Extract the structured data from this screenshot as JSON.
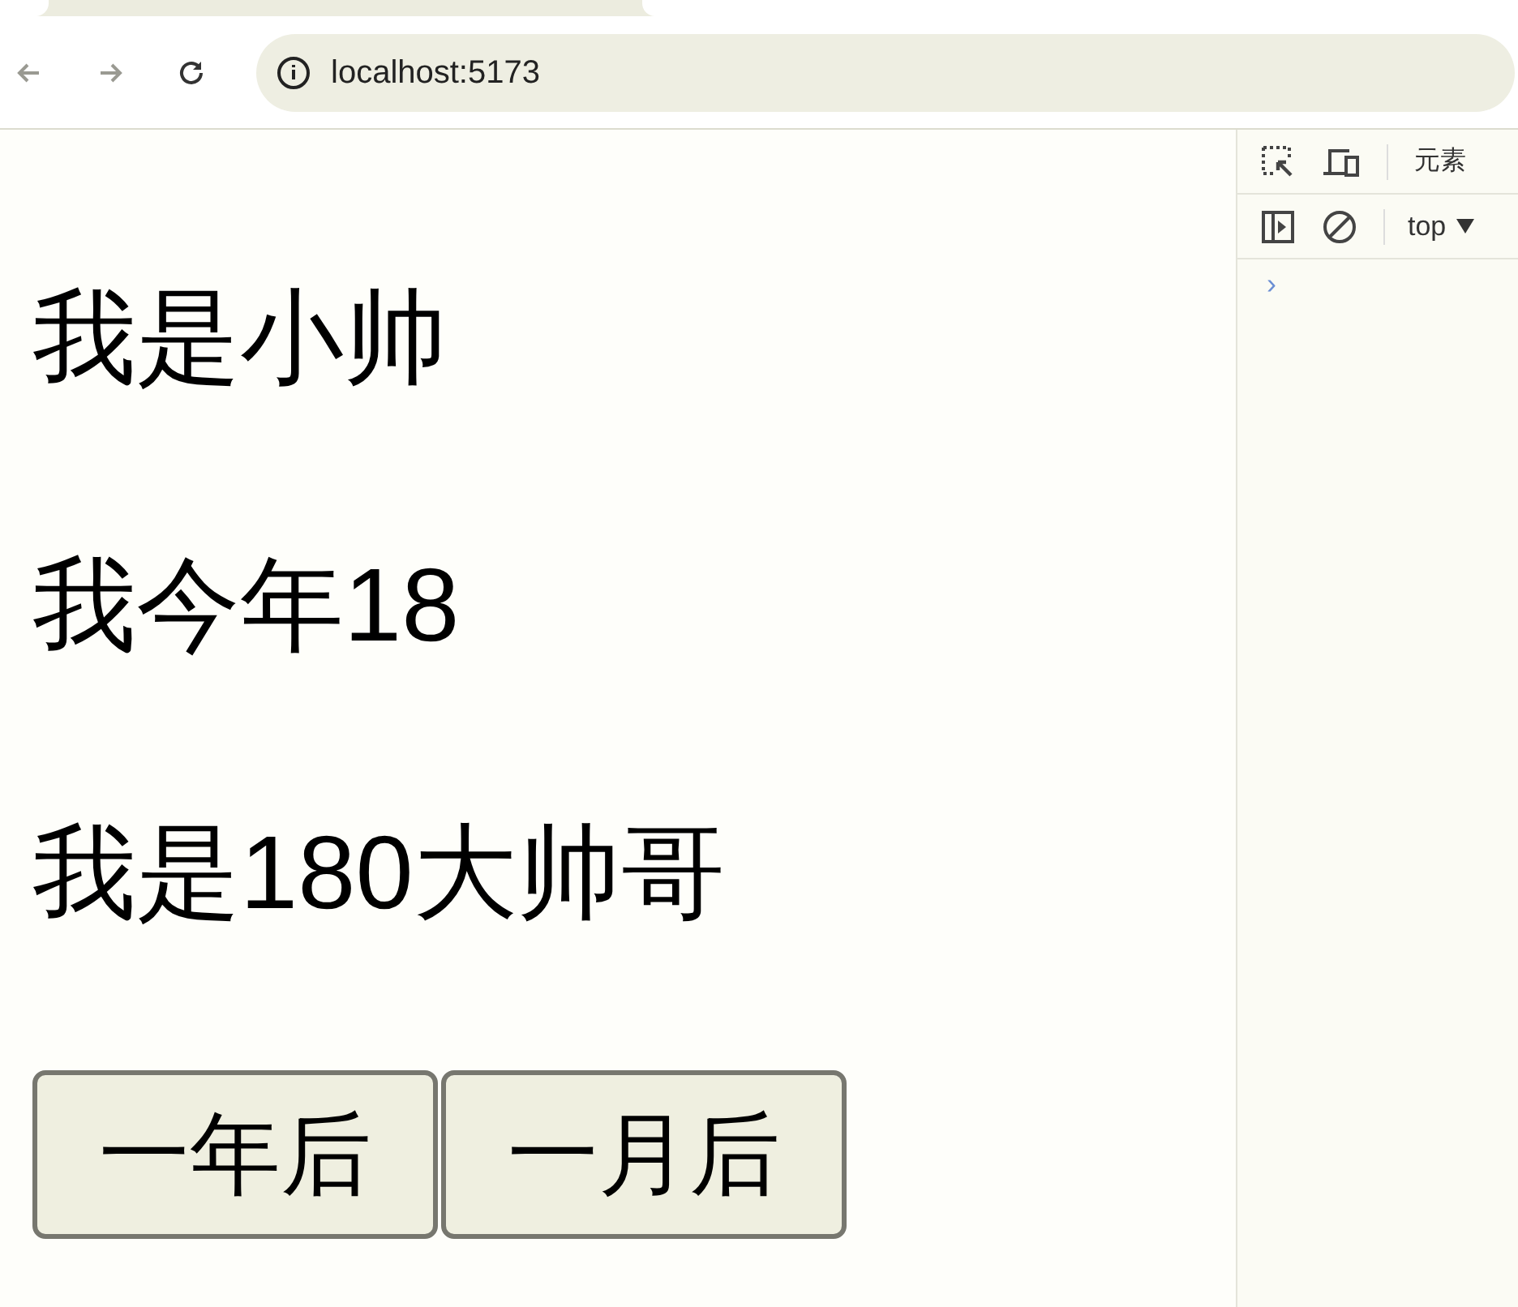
{
  "browser": {
    "url": "localhost:5173"
  },
  "page": {
    "lines": [
      "我是小帅",
      "我今年18",
      "我是180大帅哥"
    ],
    "buttons": [
      "一年后",
      "一月后"
    ]
  },
  "devtools": {
    "tab": "元素",
    "context": "top",
    "prompt": "›"
  }
}
